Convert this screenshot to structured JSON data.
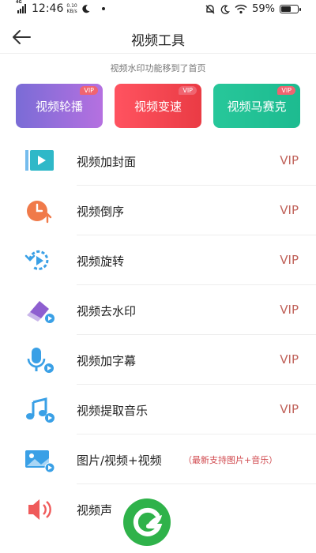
{
  "status_bar": {
    "network": "4G",
    "time": "12:46",
    "speed_value": "0.10",
    "speed_unit": "KB/s",
    "battery": "59%"
  },
  "header": {
    "title": "视频工具",
    "back_icon": "arrow-left-icon"
  },
  "notice": "视频水印功能移到了首页",
  "feature_cards": [
    {
      "label": "视频轮播",
      "badge": "VIP",
      "color": "#9a6fdc"
    },
    {
      "label": "视频变速",
      "badge": "VIP",
      "color": "#f3464f"
    },
    {
      "label": "视频马赛克",
      "badge": "VIP",
      "color": "#22c195"
    }
  ],
  "tools": [
    {
      "label": "视频加封面",
      "tag": "VIP",
      "icon": "video-cover-icon"
    },
    {
      "label": "视频倒序",
      "tag": "VIP",
      "icon": "clock-reverse-icon"
    },
    {
      "label": "视频旋转",
      "tag": "VIP",
      "icon": "rotate-icon"
    },
    {
      "label": "视频去水印",
      "tag": "VIP",
      "icon": "eraser-icon"
    },
    {
      "label": "视频加字幕",
      "tag": "VIP",
      "icon": "microphone-icon"
    },
    {
      "label": "视频提取音乐",
      "tag": "VIP",
      "icon": "music-note-icon"
    },
    {
      "label": "图片/视频+视频",
      "note": "（最新支持图片+音乐）",
      "icon": "image-video-icon"
    },
    {
      "label": "视频声",
      "icon": "speaker-icon"
    }
  ],
  "colors": {
    "vip_text": "#c0625a",
    "note_text": "#d0484d",
    "icon_blue": "#3aa0e6",
    "accent_orange": "#f07a4a",
    "logo_green": "#2fb24a"
  }
}
